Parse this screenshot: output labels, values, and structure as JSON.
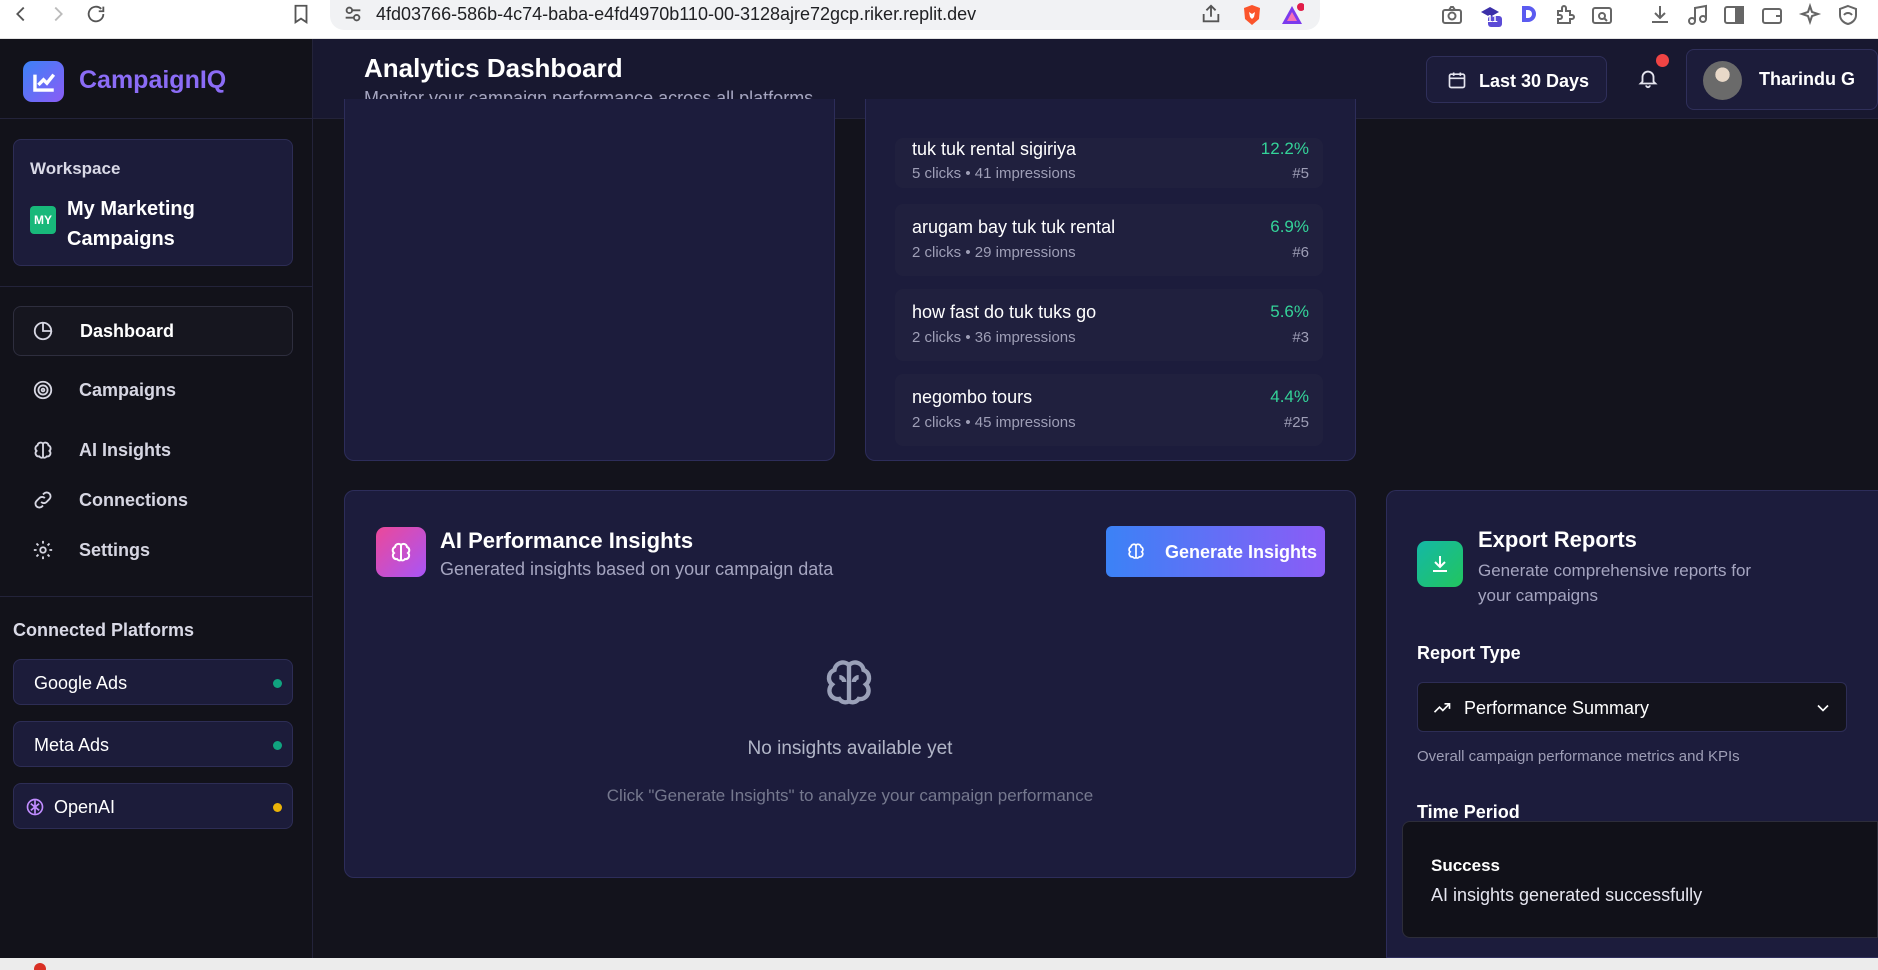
{
  "browser": {
    "url": "4fd03766-586b-4c74-baba-e4fd4970b110-00-3128ajre72gcp.riker.replit.dev",
    "extension_badge": "11",
    "icons": [
      "back-icon",
      "forward-icon",
      "reload-icon",
      "bookmark-icon",
      "site-settings-icon",
      "share-icon",
      "brave-shield-icon",
      "brave-rewards-icon",
      "camera-icon",
      "extension-icon",
      "extension-d-icon",
      "puzzle-icon",
      "tab-search-icon",
      "download-icon",
      "music-icon",
      "sidebar-icon",
      "wallet-icon",
      "leo-icon",
      "vpn-icon"
    ]
  },
  "brand": {
    "name": "CampaignIQ"
  },
  "workspace": {
    "label": "Workspace",
    "badge": "MY",
    "name": "My Marketing Campaigns"
  },
  "nav": [
    {
      "label": "Dashboard",
      "icon": "pie-chart-icon",
      "active": true
    },
    {
      "label": "Campaigns",
      "icon": "target-icon",
      "active": false
    },
    {
      "label": "AI Insights",
      "icon": "brain-icon",
      "active": false
    },
    {
      "label": "Connections",
      "icon": "link-icon",
      "active": false
    },
    {
      "label": "Settings",
      "icon": "gear-icon",
      "active": false
    }
  ],
  "connected": {
    "title": "Connected Platforms",
    "platforms": [
      {
        "label": "Google Ads",
        "status_color": "#10a37f"
      },
      {
        "label": "Meta Ads",
        "status_color": "#10a37f"
      },
      {
        "label": "OpenAI",
        "status_color": "#eab308"
      }
    ]
  },
  "header": {
    "title": "Analytics Dashboard",
    "subtitle": "Monitor your campaign performance across all platforms",
    "date_range": "Last 30 Days",
    "user_name": "Tharindu G"
  },
  "keywords": [
    {
      "name": "tuk tuk rental sigiriya",
      "meta": "5 clicks • 41 impressions",
      "rate": "12.2%",
      "rank": "#5"
    },
    {
      "name": "arugam bay tuk tuk rental",
      "meta": "2 clicks • 29 impressions",
      "rate": "6.9%",
      "rank": "#6"
    },
    {
      "name": "how fast do tuk tuks go",
      "meta": "2 clicks • 36 impressions",
      "rate": "5.6%",
      "rank": "#3"
    },
    {
      "name": "negombo tours",
      "meta": "2 clicks • 45 impressions",
      "rate": "4.4%",
      "rank": "#25"
    }
  ],
  "ai_insights": {
    "title": "AI Performance Insights",
    "subtitle": "Generated insights based on your campaign data",
    "button": "Generate Insights",
    "empty_title": "No insights available yet",
    "empty_subtitle": "Click \"Generate Insights\" to analyze your campaign performance"
  },
  "export": {
    "title": "Export Reports",
    "subtitle": "Generate comprehensive reports for your campaigns",
    "report_type_label": "Report Type",
    "report_type_value": "Performance Summary",
    "report_type_desc": "Overall campaign performance metrics and KPIs",
    "time_period_label": "Time Period"
  },
  "toast": {
    "title": "Success",
    "message": "AI insights generated successfully"
  },
  "colors": {
    "accent": "#8b5cf6",
    "success": "#34d399",
    "app_bg": "#13131c",
    "card_bg": "#1c1c3c"
  }
}
